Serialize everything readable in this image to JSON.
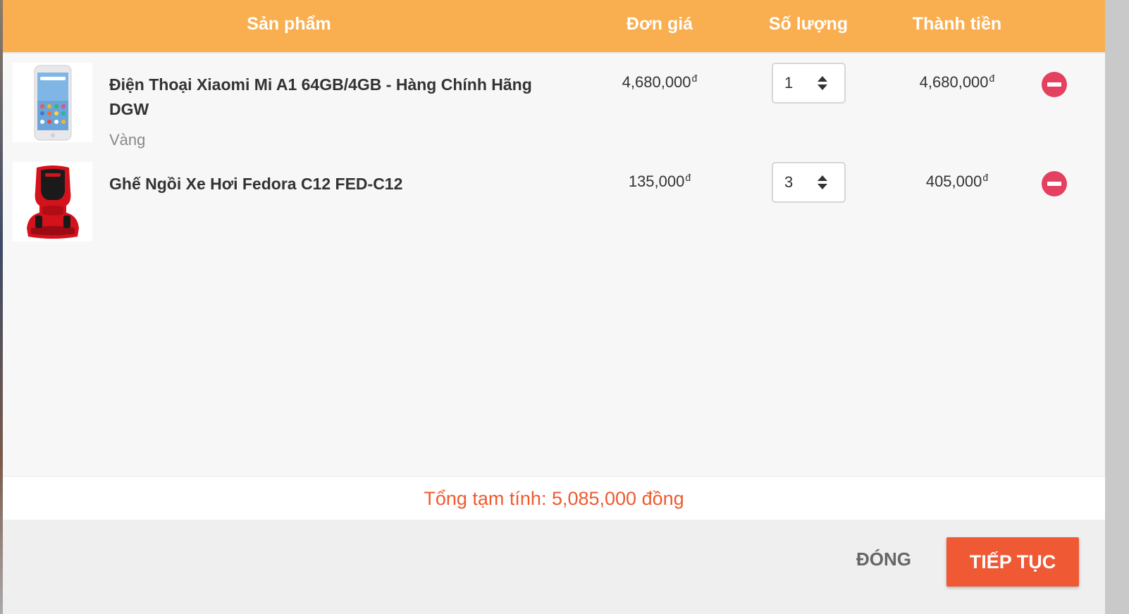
{
  "header": {
    "product": "Sản phẩm",
    "unit_price": "Đơn giá",
    "quantity": "Số lượng",
    "line_total": "Thành tiền"
  },
  "items": [
    {
      "name": "Điện Thoại Xiaomi Mi A1 64GB/4GB - Hàng Chính Hãng DGW",
      "variant": "Vàng",
      "unit_price": "4,680,000",
      "quantity": "1",
      "line_total": "4,680,000",
      "currency": "đ",
      "thumb_icon": "smartphone-icon"
    },
    {
      "name": "Ghế Ngồi Xe Hơi Fedora C12 FED-C12",
      "variant": "",
      "unit_price": "135,000",
      "quantity": "3",
      "line_total": "405,000",
      "currency": "đ",
      "thumb_icon": "car-seat-icon"
    }
  ],
  "summary": {
    "subtotal_text": "Tổng tạm tính: 5,085,000 đồng"
  },
  "footer": {
    "close_label": "ĐÓNG",
    "continue_label": "TIẾP TỤC"
  },
  "colors": {
    "header_bg": "#f9ae4f",
    "accent": "#ef5a35",
    "remove": "#e4405f"
  }
}
